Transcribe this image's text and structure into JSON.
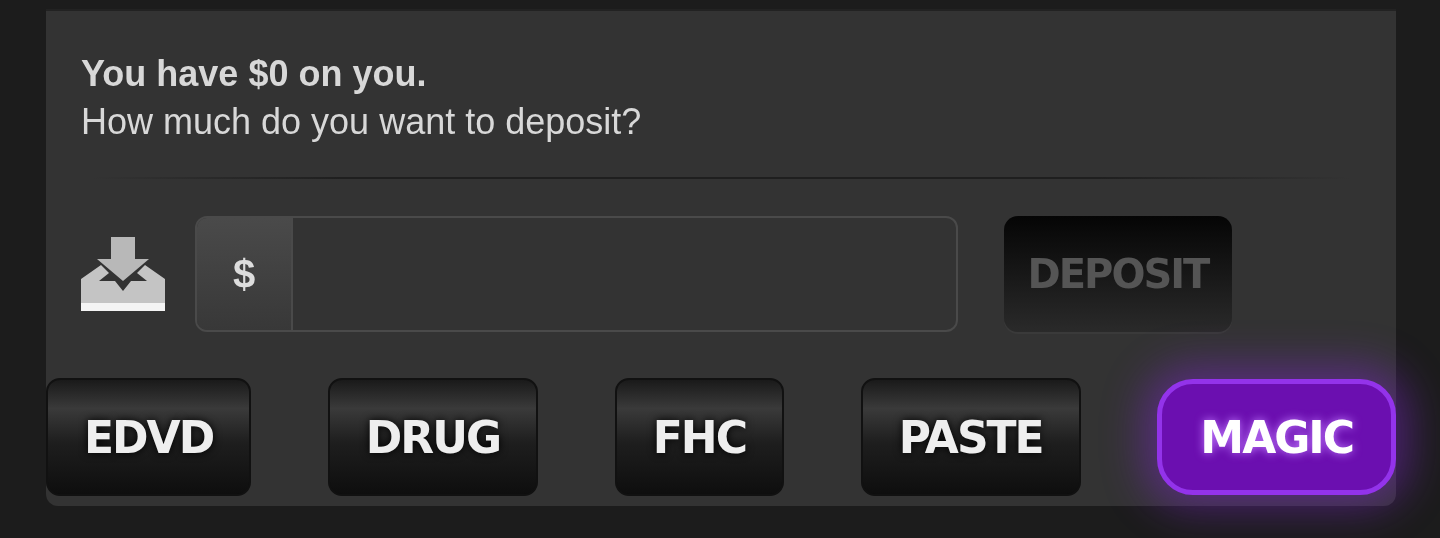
{
  "message": {
    "balance_line": "You have $0 on you.",
    "question": "How much do you want to deposit?"
  },
  "deposit_form": {
    "currency_symbol": "$",
    "button": {
      "label": "DEPOSIT",
      "disabled": true
    }
  },
  "shortcuts": [
    {
      "label": "EDVD",
      "selected": false
    },
    {
      "label": "DRUG",
      "selected": false
    },
    {
      "label": "FHC",
      "selected": false
    },
    {
      "label": "PASTE",
      "selected": false
    },
    {
      "label": "MAGIC",
      "selected": true
    }
  ]
}
